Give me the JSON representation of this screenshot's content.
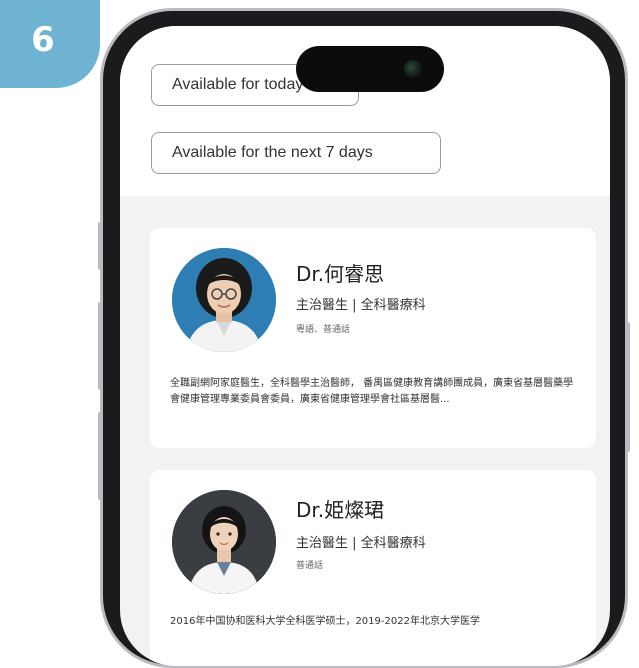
{
  "step": {
    "number": "6"
  },
  "filters": {
    "today_label": "Available for today",
    "week_label": "Available for the next 7 days"
  },
  "doctors": [
    {
      "name": "Dr.何睿思",
      "title": "主治醫生 |  全科醫療科",
      "languages": "粵語、普通話",
      "bio": "全職副網阿家庭醫生，全科醫學主治醫師， 番禺區健康教育講師團成員，廣東省基層醫藥學會健康管理專業委員會委員，廣東省健康管理學會社區基層醫..."
    },
    {
      "name": "Dr.姫燦珺",
      "title": "主治醫生 |  全科醫療科",
      "languages": "普通話",
      "bio": "2016年中国协和医科大学全科医学硕士，2019-2022年北京大学医学"
    }
  ],
  "colors": {
    "badge": "#6fb3d2",
    "phone_frame": "#1b1b1d",
    "screen_bg": "#f2f2f2"
  }
}
